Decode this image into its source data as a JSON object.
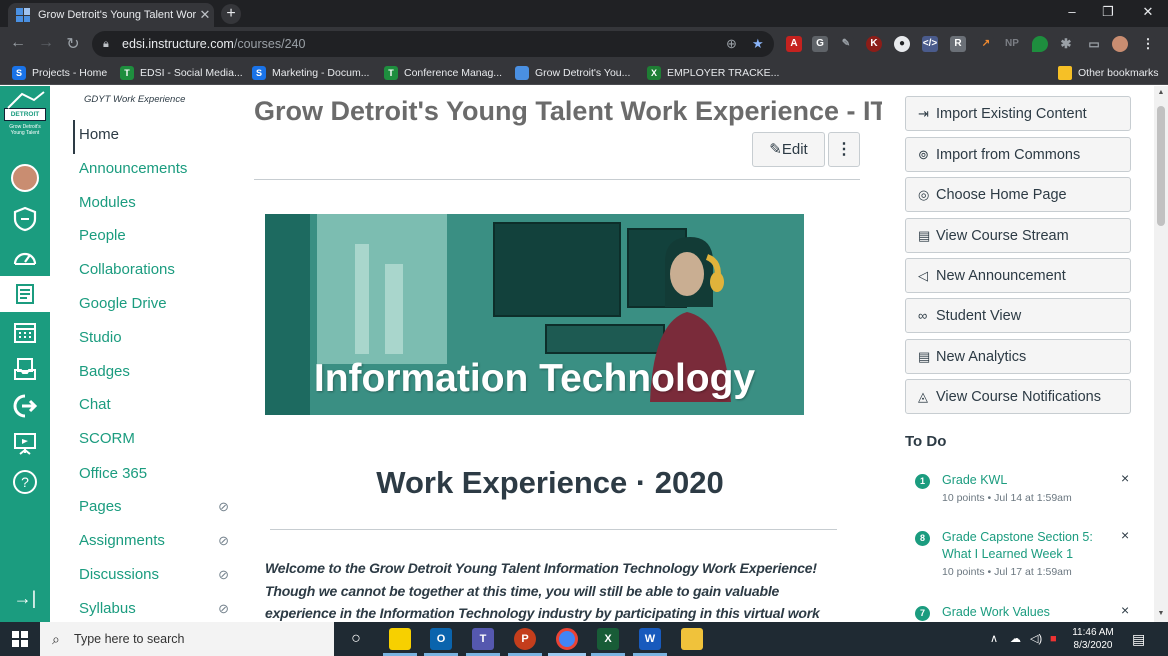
{
  "browser": {
    "tab_title": "Grow Detroit's Young Talent Wor",
    "tab_close": "✕",
    "new_tab": "+",
    "url_host": "edsi.instructure.com",
    "url_path": "/courses/240",
    "window_controls": [
      "–",
      "❐",
      "✕"
    ],
    "bookmarks": [
      {
        "label": "Projects - Home",
        "icon_color": "#1a73e8",
        "icon_text": "S"
      },
      {
        "label": "EDSI - Social Media...",
        "icon_color": "#1e8e3e",
        "icon_text": "T"
      },
      {
        "label": "Marketing - Docum...",
        "icon_color": "#1a73e8",
        "icon_text": "S"
      },
      {
        "label": "Conference Manag...",
        "icon_color": "#1e8e3e",
        "icon_text": "T"
      },
      {
        "label": "Grow Detroit's You...",
        "icon_color": "#4a90e2",
        "icon_text": ""
      },
      {
        "label": "EMPLOYER TRACKE...",
        "icon_color": "#1e7e34",
        "icon_text": "X"
      }
    ],
    "other_bookmarks": "Other bookmarks"
  },
  "global_nav": {
    "logo_text": "Grow Detroit's Young Talent",
    "logo_badge": "DETROIT",
    "items": [
      "account",
      "admin",
      "dashboard",
      "courses",
      "calendar",
      "inbox",
      "commons",
      "studio",
      "help"
    ],
    "collapse": "→|"
  },
  "course_nav": {
    "breadcrumb": "GDYT Work Experience",
    "items": [
      {
        "label": "Home",
        "hidden": false
      },
      {
        "label": "Announcements",
        "hidden": false
      },
      {
        "label": "Modules",
        "hidden": false
      },
      {
        "label": "People",
        "hidden": false
      },
      {
        "label": "Collaborations",
        "hidden": false
      },
      {
        "label": "Google Drive",
        "hidden": false
      },
      {
        "label": "Studio",
        "hidden": false
      },
      {
        "label": "Badges",
        "hidden": false
      },
      {
        "label": "Chat",
        "hidden": false
      },
      {
        "label": "SCORM",
        "hidden": false
      },
      {
        "label": "Office 365",
        "hidden": false
      },
      {
        "label": "Pages",
        "hidden": true
      },
      {
        "label": "Assignments",
        "hidden": true
      },
      {
        "label": "Discussions",
        "hidden": true
      },
      {
        "label": "Syllabus",
        "hidden": true
      }
    ]
  },
  "main": {
    "title": "Grow Detroit's Young Talent Work Experience - IT",
    "edit_label": "Edit",
    "more_label": "⋮",
    "banner_text": "Information Technology",
    "heading": "Work Experience · 2020",
    "welcome": "Welcome to the Grow Detroit Young Talent Information Technology Work Experience! Though we cannot be together at this time, you will still be able to gain valuable experience in the Information Technology industry by participating in this virtual work experience program."
  },
  "sidebar": {
    "buttons": [
      {
        "label": "Import Existing Content",
        "icon": "⇥"
      },
      {
        "label": "Import from Commons",
        "icon": "⊚"
      },
      {
        "label": "Choose Home Page",
        "icon": "◎"
      },
      {
        "label": "View Course Stream",
        "icon": "▤"
      },
      {
        "label": "New Announcement",
        "icon": "◁"
      },
      {
        "label": "Student View",
        "icon": "∞"
      },
      {
        "label": "New Analytics",
        "icon": "▤"
      },
      {
        "label": "View Course Notifications",
        "icon": "◬"
      }
    ],
    "todo_heading": "To Do",
    "todos": [
      {
        "num": "1",
        "title": "Grade KWL",
        "meta": "10 points • Jul 14 at 1:59am"
      },
      {
        "num": "8",
        "title": "Grade Capstone Section 5: What I Learned Week 1",
        "meta": "10 points • Jul 17 at 1:59am"
      },
      {
        "num": "7",
        "title": "Grade Work Values",
        "meta": ""
      }
    ],
    "dismiss": "×"
  },
  "taskbar": {
    "search_placeholder": "Type here to search",
    "time": "11:46 AM",
    "date": "8/3/2020",
    "apps": [
      {
        "name": "task-view",
        "color": "#1f2a33",
        "text": "○"
      },
      {
        "name": "sticky-notes",
        "color": "#f7d000",
        "text": ""
      },
      {
        "name": "outlook",
        "color": "#0a64ad",
        "text": "O"
      },
      {
        "name": "teams",
        "color": "#5558af",
        "text": "T"
      },
      {
        "name": "powerpoint",
        "color": "#c43e1c",
        "text": "P"
      },
      {
        "name": "chrome",
        "color": "#4285f4",
        "text": "●"
      },
      {
        "name": "excel-app",
        "color": "#185c37",
        "text": "X"
      },
      {
        "name": "word",
        "color": "#185abd",
        "text": "W"
      },
      {
        "name": "file-explorer",
        "color": "#f0c23b",
        "text": ""
      }
    ]
  }
}
